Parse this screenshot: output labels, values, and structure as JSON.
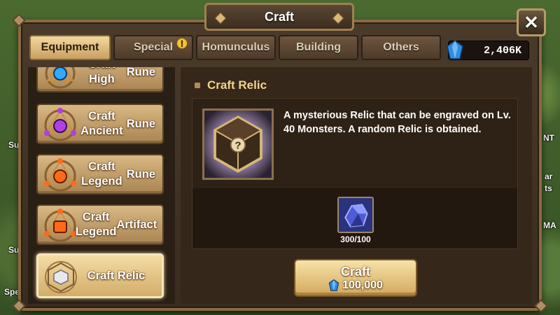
{
  "window": {
    "title": "Craft",
    "close_label": "✕"
  },
  "tabs": [
    {
      "label": "Equipment",
      "active": true
    },
    {
      "label": "Special",
      "alert": "!"
    },
    {
      "label": "Homunculus"
    },
    {
      "label": "Building"
    },
    {
      "label": "Others"
    }
  ],
  "currency": {
    "amount": "2,406K",
    "icon": "crystal-gem-icon"
  },
  "list": {
    "items": [
      {
        "line1": "Craft High",
        "line2": "Rune",
        "icon": "high-rune-icon",
        "color": "#33aaff"
      },
      {
        "line1": "Craft Ancient",
        "line2": "Rune",
        "icon": "ancient-rune-icon",
        "color": "#b040e0"
      },
      {
        "line1": "Craft Legend",
        "line2": "Rune",
        "icon": "legend-rune-icon",
        "color": "#ff6a1a"
      },
      {
        "line1": "Craft Legend",
        "line2": "Artifact",
        "icon": "legend-artifact-icon",
        "color": "#ff6a1a"
      },
      {
        "line1": "Craft Relic",
        "line2": "",
        "icon": "relic-icon",
        "selected": true
      }
    ]
  },
  "detail": {
    "title": "Craft Relic",
    "description": "A mysterious Relic that can be engraved on Lv. 40 Monsters. A random Relic is obtained.",
    "material_count": "300/100",
    "material_icon": "crystal-ore-icon"
  },
  "craft_button": {
    "label": "Craft",
    "cost": "100,000",
    "cost_icon": "crystal-gem-icon"
  },
  "background": {
    "labels": [
      "Su",
      "Su",
      "Spe",
      "NT",
      "MA",
      "ar",
      "ts"
    ]
  }
}
